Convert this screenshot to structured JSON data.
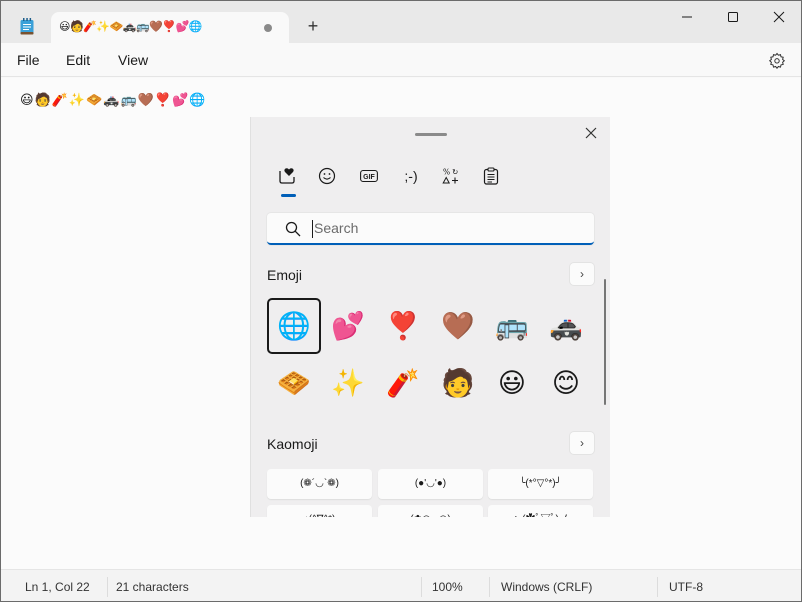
{
  "window": {
    "tab_title": "😃🧑🧨✨🧇🚓🚌🤎❣️💕🌐",
    "new_tab_label": "+",
    "controls": {
      "minimize": "minimize",
      "maximize": "maximize",
      "close": "close"
    }
  },
  "menu": {
    "items": [
      "File",
      "Edit",
      "View"
    ],
    "settings_icon": "gear-icon"
  },
  "editor": {
    "content": "😃🧑🧨✨🧇🚓🚌🤎❣️💕🌐"
  },
  "status": {
    "position": "Ln 1, Col 22",
    "characters": "21 characters",
    "zoom": "100%",
    "line_ending": "Windows (CRLF)",
    "encoding": "UTF-8"
  },
  "emoji_panel": {
    "tabs": [
      {
        "name": "favorites",
        "icon": "heart-box-icon",
        "active": true
      },
      {
        "name": "emoji",
        "icon": "smiley-icon",
        "active": false
      },
      {
        "name": "gif",
        "icon": "gif-icon",
        "active": false,
        "label": "GIF"
      },
      {
        "name": "kaomoji",
        "icon": "kaomoji-icon",
        "active": false,
        "label": ";-)"
      },
      {
        "name": "symbols",
        "icon": "symbols-icon",
        "active": false
      },
      {
        "name": "clipboard",
        "icon": "clipboard-icon",
        "active": false
      }
    ],
    "search": {
      "placeholder": "Search",
      "value": ""
    },
    "emoji_section": {
      "title": "Emoji",
      "more_label": "›",
      "items": [
        "🌐",
        "💕",
        "❣️",
        "🤎",
        "🚌",
        "🚓",
        "🧇",
        "✨",
        "🧨",
        "🧑",
        "😃",
        "😊"
      ],
      "selected_index": 0
    },
    "kaomoji_section": {
      "title": "Kaomoji",
      "more_label": "›",
      "items": [
        "(❁´◡`❁)",
        "(●'◡'●)",
        "╰(*°▽°*)╯",
        "♪(^∇^*)",
        "(✿◠‿◠)",
        "ヽ(✿ﾟ▽ﾟ)ノ"
      ]
    }
  },
  "colors": {
    "accent": "#005fb8",
    "panel_bg": "#efeeef",
    "titlebar_bg": "#e9e9e9"
  }
}
